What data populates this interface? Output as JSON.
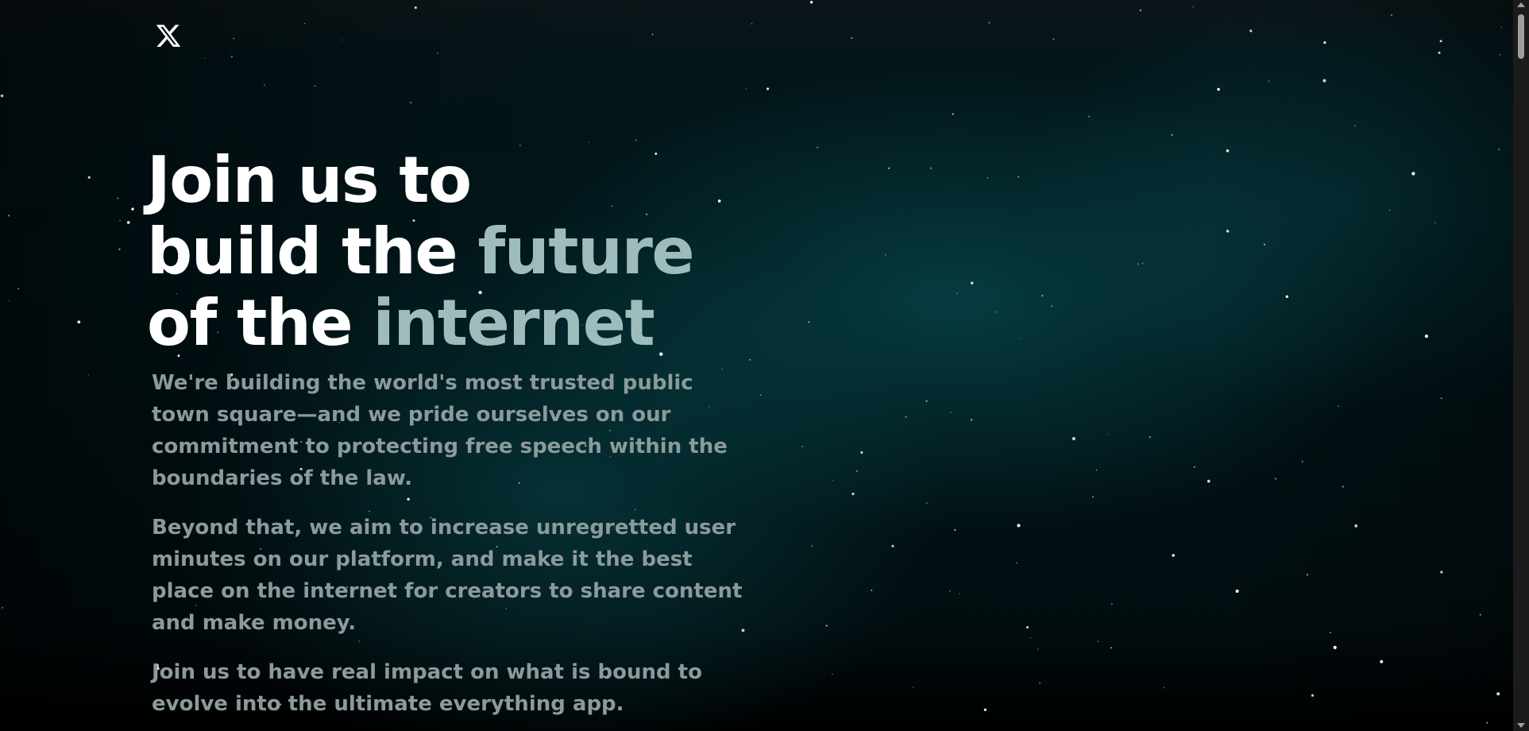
{
  "brand": {
    "logo_icon": "x-logo-icon",
    "logo_glyph": "𝕏"
  },
  "hero": {
    "headline": {
      "line1": "Join us to",
      "line2_plain": "build the ",
      "line2_accent": "future",
      "line3_plain": "of the ",
      "line3_accent": "internet"
    },
    "paragraphs": [
      "We're building the world's most trusted public town square—and we pride ourselves on our commitment to protecting free speech within the boundaries of the law.",
      "Beyond that, we aim to increase unregretted user minutes on our platform, and make it the best place on the internet for creators to share content and make money.",
      "Join us to have real impact on what is bound to evolve into the ultimate everything app."
    ]
  },
  "colors": {
    "headline": "#ffffff",
    "accent": "#9fbcbd",
    "body_text": "#8c9a9c",
    "background_glow": "#0a5a5f"
  }
}
